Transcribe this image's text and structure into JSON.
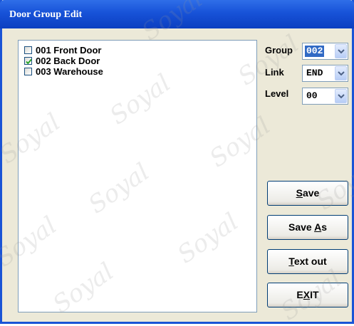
{
  "window": {
    "title": "Door Group Edit"
  },
  "list": {
    "items": [
      {
        "label": "001 Front Door",
        "checked": false
      },
      {
        "label": "002 Back Door",
        "checked": true
      },
      {
        "label": "003 Warehouse",
        "checked": false
      }
    ]
  },
  "fields": {
    "group": {
      "label": "Group",
      "value": "002"
    },
    "link": {
      "label": "Link",
      "value": "END"
    },
    "level": {
      "label": "Level",
      "value": "00"
    }
  },
  "buttons": {
    "save": {
      "label": "Save",
      "mnemonic": "S"
    },
    "save_as": {
      "label": "Save As",
      "mnemonic": "A"
    },
    "text_out": {
      "label": "Text out",
      "mnemonic": "T"
    },
    "exit": {
      "label": "EXIT",
      "mnemonic": "X"
    }
  },
  "watermark": {
    "text": "Soyal"
  },
  "colors": {
    "title_bar": "#1752d8",
    "selection": "#316ac5",
    "window_bg": "#ece9d8"
  },
  "icons": {
    "combo_arrow": "chevron-down-icon",
    "check": "check-icon"
  }
}
